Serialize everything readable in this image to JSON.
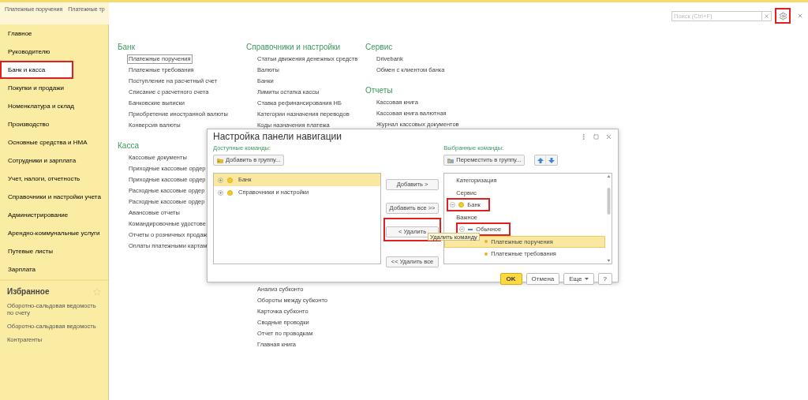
{
  "top_tabs": [
    "Платежные поручения",
    "Платежные тр"
  ],
  "sidebar": {
    "items": [
      {
        "label": "Главное",
        "selected": false,
        "highlighted": false
      },
      {
        "label": "Руководителю",
        "selected": false,
        "highlighted": false
      },
      {
        "label": "Банк и касса",
        "selected": true,
        "highlighted": true
      },
      {
        "label": "Покупки и продажи",
        "selected": false,
        "highlighted": false
      },
      {
        "label": "Номенклатура и склад",
        "selected": false,
        "highlighted": false
      },
      {
        "label": "Производство",
        "selected": false,
        "highlighted": false
      },
      {
        "label": "Основные средства и НМА",
        "selected": false,
        "highlighted": false
      },
      {
        "label": "Сотрудники и зарплата",
        "selected": false,
        "highlighted": false
      },
      {
        "label": "Учет, налоги, отчетность",
        "selected": false,
        "highlighted": false
      },
      {
        "label": "Справочники и настройки учета",
        "selected": false,
        "highlighted": false
      },
      {
        "label": "Администрирование",
        "selected": false,
        "highlighted": false
      },
      {
        "label": "Арендно-коммунальные услуги",
        "selected": false,
        "highlighted": false
      },
      {
        "label": "Путевые листы",
        "selected": false,
        "highlighted": false
      },
      {
        "label": "Зарплата",
        "selected": false,
        "highlighted": false
      }
    ],
    "favorites": {
      "title": "Избранное",
      "items": [
        "Оборотно-сальдовая ведомость по счету",
        "Оборотно-сальдовая ведомость",
        "Контрагенты"
      ]
    }
  },
  "search": {
    "placeholder": "Поиск (Ctrl+F)"
  },
  "settings_button": {
    "highlighted": true
  },
  "sections": [
    {
      "groups": [
        {
          "title": "Банк",
          "items": [
            {
              "label": "Платежные поручения",
              "focused": true
            },
            {
              "label": "Платежные требования",
              "focused": false
            },
            {
              "label": "Поступление на расчетный счет",
              "focused": false
            },
            {
              "label": "Списание с расчетного счета",
              "focused": false
            },
            {
              "label": "Банковские выписки",
              "focused": false
            },
            {
              "label": "Приобретение иностранной валюты",
              "focused": false
            },
            {
              "label": "Конверсия валюты",
              "focused": false
            }
          ]
        },
        {
          "title": "Касса",
          "items": [
            {
              "label": "Кассовые документы",
              "focused": false
            },
            {
              "label": "Приходные кассовые ордер",
              "focused": false
            },
            {
              "label": "Приходные кассовые ордер",
              "focused": false
            },
            {
              "label": "Расходные кассовые ордер",
              "focused": false
            },
            {
              "label": "Расходные кассовые ордер",
              "focused": false
            },
            {
              "label": "Авансовые отчеты",
              "focused": false
            },
            {
              "label": "Командировочные удостове",
              "focused": false
            },
            {
              "label": "Отчеты о розничных продаж",
              "focused": false
            },
            {
              "label": "Оплаты платежными картам",
              "focused": false
            }
          ]
        }
      ]
    },
    {
      "groups": [
        {
          "title": "Справочники и настройки",
          "items": [
            {
              "label": "Статьи движения денежных средств",
              "focused": false
            },
            {
              "label": "Валюты",
              "focused": false
            },
            {
              "label": "Банки",
              "focused": false
            },
            {
              "label": "Лимиты остатка кассы",
              "focused": false
            },
            {
              "label": "Ставка рефинансирования НБ",
              "focused": false
            },
            {
              "label": "Категории назначения переводов",
              "focused": false
            },
            {
              "label": "Коды назначения платежа",
              "focused": false
            }
          ]
        },
        {
          "items": [
            {
              "label": "Анализ субконто",
              "focused": false
            },
            {
              "label": "Обороты между субконто",
              "focused": false
            },
            {
              "label": "Карточка субконто",
              "focused": false
            },
            {
              "label": "Сводные проводки",
              "focused": false
            },
            {
              "label": "Отчет по проводкам",
              "focused": false
            },
            {
              "label": "Главная книга",
              "focused": false
            }
          ]
        }
      ]
    },
    {
      "groups": [
        {
          "title": "Сервис",
          "items": [
            {
              "label": "Drivebank",
              "focused": false
            },
            {
              "label": "Обмен с клиентом банка",
              "focused": false
            }
          ]
        },
        {
          "title": "Отчеты",
          "items": [
            {
              "label": "Кассовая книга",
              "focused": false
            },
            {
              "label": "Кассовая книга валютная",
              "focused": false
            },
            {
              "label": "Журнал кассовых документов",
              "focused": false
            }
          ]
        }
      ]
    }
  ],
  "dialog": {
    "title": "Настройка панели навигации",
    "available": {
      "label": "Доступные команды:",
      "button": "Добавить в группу...",
      "items": [
        {
          "label": "Банк",
          "selected": true,
          "expanded": false
        },
        {
          "label": "Справочники и настройки",
          "selected": false,
          "expanded": false
        }
      ]
    },
    "actions": [
      {
        "label": "Добавить >",
        "highlighted": false
      },
      {
        "label": "Добавить все >>",
        "highlighted": false
      },
      {
        "label": "< Удалить",
        "highlighted": true
      },
      {
        "label": "<< Удалить все",
        "highlighted": false
      }
    ],
    "tooltip": "Удалить команду",
    "chosen": {
      "label": "Выбранные команды:",
      "button": "Переместить в группу...",
      "items": [
        {
          "label": "Категоризация",
          "kind": "plain",
          "selected": false,
          "highlighted": false
        },
        {
          "label": "Сервис",
          "kind": "plain",
          "selected": false,
          "highlighted": false
        },
        {
          "label": "Банк",
          "kind": "group",
          "expanded": true,
          "selected": false,
          "highlighted": true,
          "children": [
            {
              "label": "Важное",
              "kind": "plain",
              "selected": false,
              "highlighted": false
            },
            {
              "label": "Обычное",
              "kind": "subgroup",
              "expanded": true,
              "selected": false,
              "highlighted": true,
              "children": [
                {
                  "label": "Платежные поручения",
                  "kind": "command",
                  "selected": true,
                  "highlighted": false
                },
                {
                  "label": "Платежные требования",
                  "kind": "command",
                  "selected": false,
                  "highlighted": false
                }
              ]
            }
          ]
        }
      ]
    },
    "footer": [
      {
        "label": "OK",
        "kind": "default"
      },
      {
        "label": "Отмена",
        "kind": "plain"
      },
      {
        "label": "Еще",
        "kind": "menu"
      },
      {
        "label": "?",
        "kind": "plain"
      }
    ]
  }
}
